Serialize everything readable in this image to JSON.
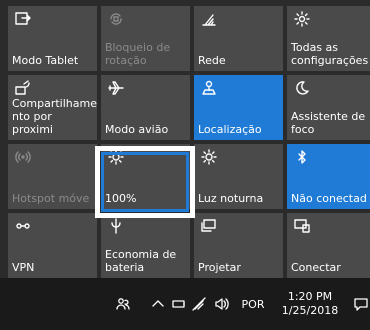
{
  "tiles": [
    {
      "label": "Modo Tablet",
      "icon": "tablet-mode-icon",
      "state": "normal"
    },
    {
      "label": "Bloqueio de rotação",
      "icon": "rotation-lock-icon",
      "state": "disabled"
    },
    {
      "label": "Rede",
      "icon": "network-icon",
      "state": "normal"
    },
    {
      "label": "Todas as configurações",
      "icon": "settings-gear-icon",
      "state": "normal"
    },
    {
      "label": "Compartilhamento por proximidade",
      "label_display": "Compartilhame nto por proximi",
      "icon": "nearby-sharing-icon",
      "state": "normal"
    },
    {
      "label": "Modo avião",
      "icon": "airplane-icon",
      "state": "normal"
    },
    {
      "label": "Localização",
      "icon": "location-icon",
      "state": "active"
    },
    {
      "label": "Assistente de foco",
      "icon": "focus-assist-icon",
      "state": "normal"
    },
    {
      "label": "Hotspot móvel",
      "label_display": "Hotspot móve",
      "icon": "mobile-hotspot-icon",
      "state": "disabled"
    },
    {
      "label": "100%",
      "icon": "brightness-icon",
      "state": "normal"
    },
    {
      "label": "Luz noturna",
      "icon": "night-light-icon",
      "state": "normal"
    },
    {
      "label": "Não conectado",
      "label_display": "Não conectad",
      "icon": "bluetooth-icon",
      "state": "active"
    },
    {
      "label": "VPN",
      "icon": "vpn-icon",
      "state": "normal"
    },
    {
      "label": "Economia de bateria",
      "icon": "battery-saver-icon",
      "state": "normal"
    },
    {
      "label": "Projetar",
      "icon": "project-icon",
      "state": "normal"
    },
    {
      "label": "Conectar",
      "icon": "connect-icon",
      "state": "normal"
    }
  ],
  "taskbar": {
    "language": "POR",
    "time": "1:20 PM",
    "date": "1/25/2018"
  },
  "colors": {
    "accent": "#1f7bd6",
    "tile": "#4a4a4a",
    "panel": "#2b2b2b",
    "highlight_outer": "#ffffff"
  }
}
